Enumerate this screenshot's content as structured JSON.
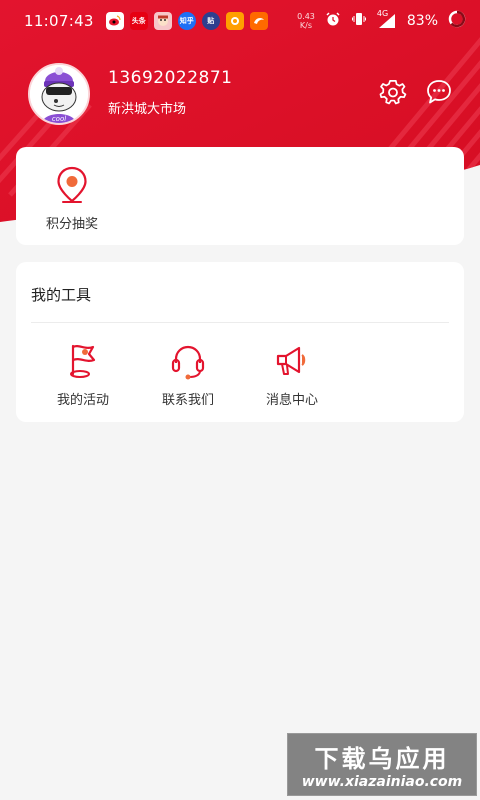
{
  "status_bar": {
    "time": "11:07:43",
    "app_icons": [
      "weibo-icon",
      "toutiao-icon",
      "avatar-app-icon",
      "zhihu-icon",
      "tieba-icon",
      "ucweb-icon",
      "alibaba-icon"
    ],
    "net_speed_value": "0.43",
    "net_speed_unit": "K/s",
    "signal_label": "4G",
    "battery": "83%"
  },
  "profile": {
    "phone": "13692022871",
    "market": "新洪城大市场",
    "avatar_text": "cool"
  },
  "header": {
    "settings_icon": "gear-icon",
    "message_icon": "chat-bubble-icon"
  },
  "points_card": {
    "items": [
      {
        "label": "积分抽奖",
        "icon": "map-pin-icon"
      }
    ]
  },
  "tools_card": {
    "title": "我的工具",
    "items": [
      {
        "label": "我的活动",
        "icon": "flag-icon"
      },
      {
        "label": "联系我们",
        "icon": "headset-icon"
      },
      {
        "label": "消息中心",
        "icon": "megaphone-icon"
      }
    ]
  },
  "watermark": {
    "title": "下载乌应用",
    "url": "www.xiazainiao.com"
  },
  "colors": {
    "brand_red": "#e3142e",
    "accent_orange": "#f06a3a",
    "background": "#f5f5f5"
  }
}
